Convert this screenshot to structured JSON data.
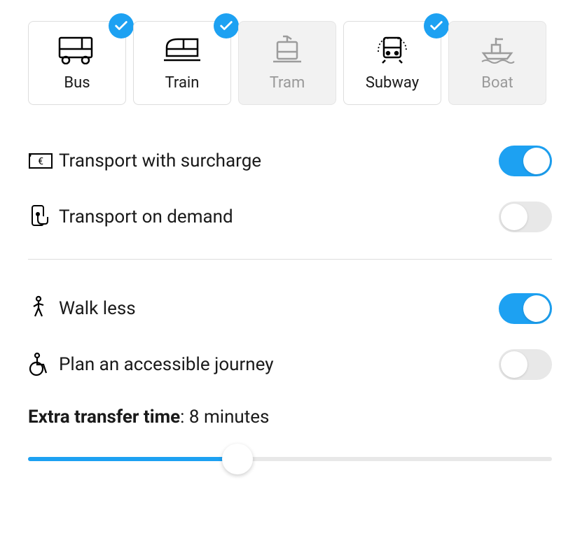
{
  "transport_modes": [
    {
      "key": "bus",
      "label": "Bus",
      "selected": true,
      "enabled": true
    },
    {
      "key": "train",
      "label": "Train",
      "selected": true,
      "enabled": true
    },
    {
      "key": "tram",
      "label": "Tram",
      "selected": false,
      "enabled": false
    },
    {
      "key": "subway",
      "label": "Subway",
      "selected": true,
      "enabled": true
    },
    {
      "key": "boat",
      "label": "Boat",
      "selected": false,
      "enabled": false
    }
  ],
  "options": {
    "surcharge": {
      "label": "Transport with surcharge",
      "on": true
    },
    "on_demand": {
      "label": "Transport on demand",
      "on": false
    },
    "walk_less": {
      "label": "Walk less",
      "on": true
    },
    "accessible": {
      "label": "Plan an accessible journey",
      "on": false
    }
  },
  "transfer": {
    "label_bold": "Extra transfer time",
    "label_value": ": 8 minutes",
    "value": 8,
    "min": 0,
    "max": 20,
    "percent": 40
  }
}
